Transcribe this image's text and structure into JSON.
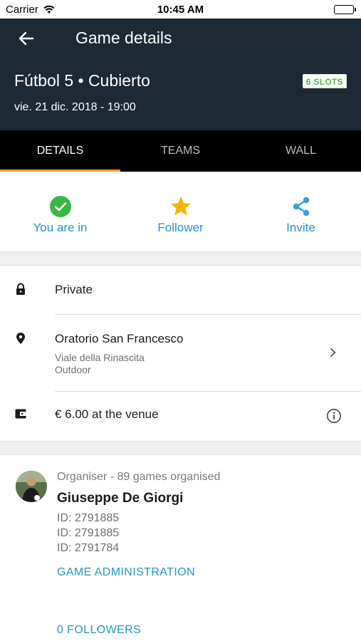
{
  "status_bar": {
    "carrier": "Carrier",
    "time": "10:45 AM"
  },
  "header": {
    "title": "Game details",
    "game_title": "Fútbol 5 • Cubierto",
    "date": "vie. 21 dic. 2018 - 19:00",
    "slots_badge": "6 SLOTS",
    "background_color": "#1d2935"
  },
  "tabs": [
    {
      "label": "DETAILS",
      "active": true
    },
    {
      "label": "TEAMS",
      "active": false
    },
    {
      "label": "WALL",
      "active": false
    }
  ],
  "actions": [
    {
      "label": "You are in",
      "icon": "check-circle-icon",
      "color": "#3bb54a"
    },
    {
      "label": "Follower",
      "icon": "star-icon",
      "color": "#f5b400"
    },
    {
      "label": "Invite",
      "icon": "share-icon",
      "color": "#3a9fd6"
    }
  ],
  "info": {
    "privacy": "Private",
    "venue_name": "Oratorio San Francesco",
    "venue_address": "Viale della Rinascita",
    "venue_type": "Outdoor",
    "price": "€ 6.00 at the venue"
  },
  "organiser": {
    "caption": "Organiser - 89 games organised",
    "name": "Giuseppe De Giorgi",
    "ids": [
      "ID: 2791885",
      "ID: 2791885",
      "ID: 2791784"
    ],
    "admin_link": "GAME ADMINISTRATION",
    "followers_link": "0 FOLLOWERS"
  },
  "colors": {
    "accent_orange": "#f39c34",
    "link_blue": "#1f97c9",
    "slots_green": "#55b84a"
  }
}
